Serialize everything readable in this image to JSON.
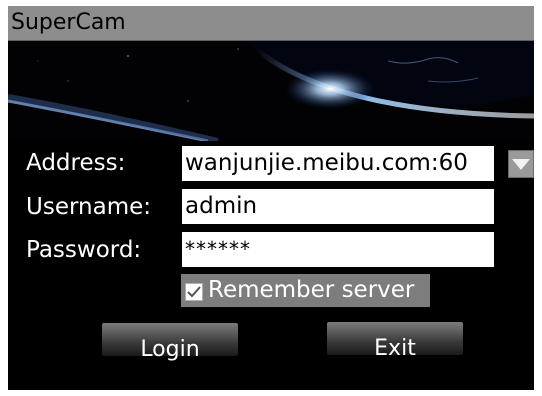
{
  "app": {
    "title": "SuperCam"
  },
  "form": {
    "address": {
      "label": "Address:",
      "value": "wanjunjie.meibu.com:60"
    },
    "username": {
      "label": "Username:",
      "value": "admin"
    },
    "password": {
      "label": "Password:",
      "value": "******"
    },
    "remember": {
      "label": "Remember server",
      "checked": true
    }
  },
  "buttons": {
    "login_label": "Login",
    "exit_label": "Exit"
  },
  "icons": {
    "dropdown": "triangle-down-icon",
    "checkbox": "check-icon",
    "banner": "earth-horizon-image"
  },
  "colors": {
    "background": "#000000",
    "title_bar": "#8d8d8d",
    "highlight": "#7d7d7d",
    "input_background": "#ffffff"
  }
}
